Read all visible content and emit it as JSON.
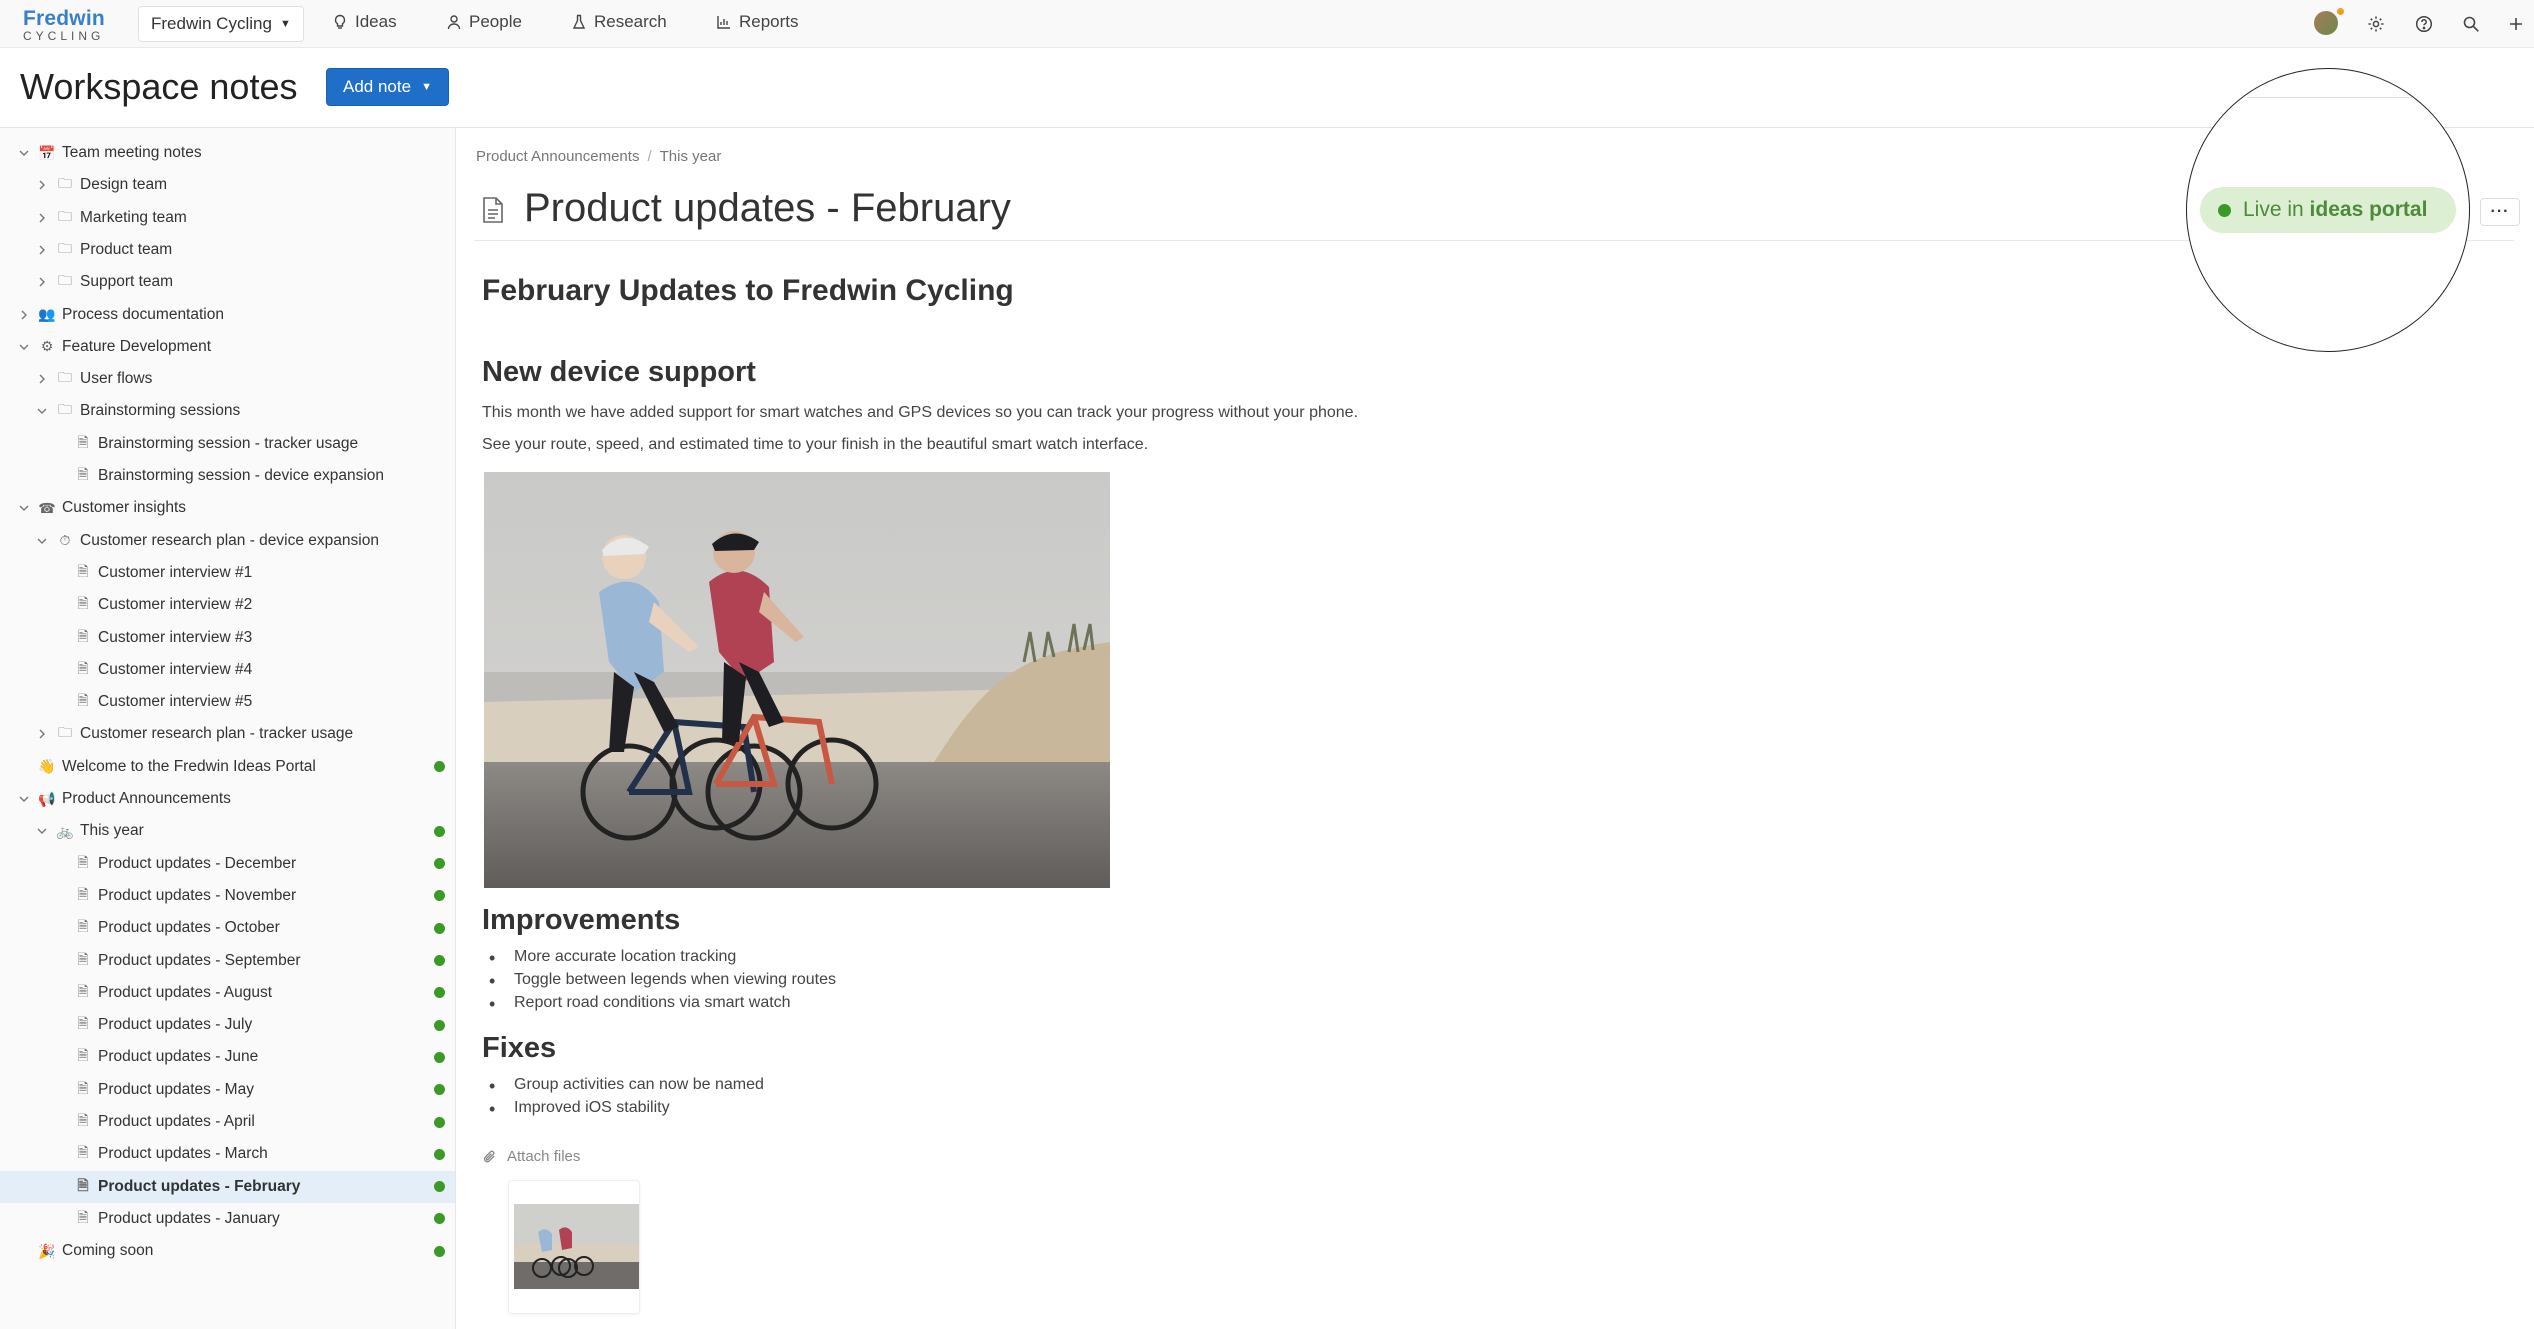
{
  "logo": {
    "top": "Fredwin",
    "bottom": "CYCLING"
  },
  "workspace": {
    "name": "Fredwin Cycling"
  },
  "nav": {
    "ideas": "Ideas",
    "people": "People",
    "research": "Research",
    "reports": "Reports"
  },
  "header": {
    "title": "Workspace notes",
    "add_note": "Add note"
  },
  "sidebar": {
    "items": [
      {
        "label": "Team meeting notes",
        "icon": "calendar-emoji",
        "expanded": true,
        "live": false
      },
      {
        "label": "Design team",
        "icon": "folder-icon",
        "expanded": false,
        "live": false
      },
      {
        "label": "Marketing team",
        "icon": "folder-icon",
        "expanded": false,
        "live": false
      },
      {
        "label": "Product team",
        "icon": "folder-icon",
        "expanded": false,
        "live": false
      },
      {
        "label": "Support team",
        "icon": "folder-icon",
        "expanded": false,
        "live": false
      },
      {
        "label": "Process documentation",
        "icon": "people-emoji",
        "expanded": false,
        "live": false
      },
      {
        "label": "Feature Development",
        "icon": "gear-emoji",
        "expanded": true,
        "live": false
      },
      {
        "label": "User flows",
        "icon": "folder-icon",
        "expanded": false,
        "live": false
      },
      {
        "label": "Brainstorming sessions",
        "icon": "folder-icon",
        "expanded": true,
        "live": false
      },
      {
        "label": "Brainstorming session - tracker usage",
        "icon": "document-icon",
        "live": false
      },
      {
        "label": "Brainstorming session - device expansion",
        "icon": "document-icon",
        "live": false
      },
      {
        "label": "Customer insights",
        "icon": "telephone-emoji",
        "expanded": true,
        "live": false
      },
      {
        "label": "Customer research plan - device expansion",
        "icon": "stopwatch-emoji",
        "expanded": true,
        "live": false
      },
      {
        "label": "Customer interview #1",
        "icon": "document-icon",
        "live": false
      },
      {
        "label": "Customer interview #2",
        "icon": "document-icon",
        "live": false
      },
      {
        "label": "Customer interview #3",
        "icon": "document-icon",
        "live": false
      },
      {
        "label": "Customer interview #4",
        "icon": "document-icon",
        "live": false
      },
      {
        "label": "Customer interview #5",
        "icon": "document-icon",
        "live": false
      },
      {
        "label": "Customer research plan - tracker usage",
        "icon": "folder-icon",
        "expanded": false,
        "live": false
      },
      {
        "label": "Welcome to the Fredwin Ideas Portal",
        "icon": "wave-emoji",
        "live": true
      },
      {
        "label": "Product Announcements",
        "icon": "megaphone-emoji",
        "expanded": true,
        "live": false
      },
      {
        "label": "This year",
        "icon": "bike-emoji",
        "expanded": true,
        "live": true
      },
      {
        "label": "Product updates - December",
        "icon": "document-icon",
        "live": true
      },
      {
        "label": "Product updates - November",
        "icon": "document-icon",
        "live": true
      },
      {
        "label": "Product updates - October",
        "icon": "document-icon",
        "live": true
      },
      {
        "label": "Product updates - September",
        "icon": "document-icon",
        "live": true
      },
      {
        "label": "Product updates - August",
        "icon": "document-icon",
        "live": true
      },
      {
        "label": "Product updates - July",
        "icon": "document-icon",
        "live": true
      },
      {
        "label": "Product updates - June",
        "icon": "document-icon",
        "live": true
      },
      {
        "label": "Product updates - May",
        "icon": "document-icon",
        "live": true
      },
      {
        "label": "Product updates - April",
        "icon": "document-icon",
        "live": true
      },
      {
        "label": "Product updates - March",
        "icon": "document-icon",
        "live": true
      },
      {
        "label": "Product updates - February",
        "icon": "document-icon",
        "live": true,
        "selected": true
      },
      {
        "label": "Product updates - January",
        "icon": "document-icon",
        "live": true
      },
      {
        "label": "Coming soon",
        "icon": "party-emoji",
        "live": true
      }
    ]
  },
  "breadcrumb": {
    "parent": "Product Announcements",
    "current": "This year"
  },
  "doc": {
    "title": "Product updates - February",
    "heading": "February Updates to Fredwin Cycling",
    "section1": "New device support",
    "para1": "This month we have added support for smart watches and GPS devices so you can track your progress without your phone.",
    "para2": "See your route, speed, and estimated time to your finish in the beautiful smart watch interface.",
    "section2": "Improvements",
    "improvements": [
      "More accurate location tracking",
      "Toggle between legends when viewing routes",
      "Report road conditions via smart watch"
    ],
    "section3": "Fixes",
    "fixes": [
      "Group activities can now be named",
      "Improved iOS stability"
    ],
    "attach": "Attach files"
  },
  "status": {
    "prefix": "Live in",
    "portal": "ideas portal",
    "more": "···"
  },
  "colors": {
    "accent": "#1f6fc9",
    "live": "#3b9a27",
    "live_bg": "#dcefd3",
    "selected_bg": "#e3eef9"
  }
}
